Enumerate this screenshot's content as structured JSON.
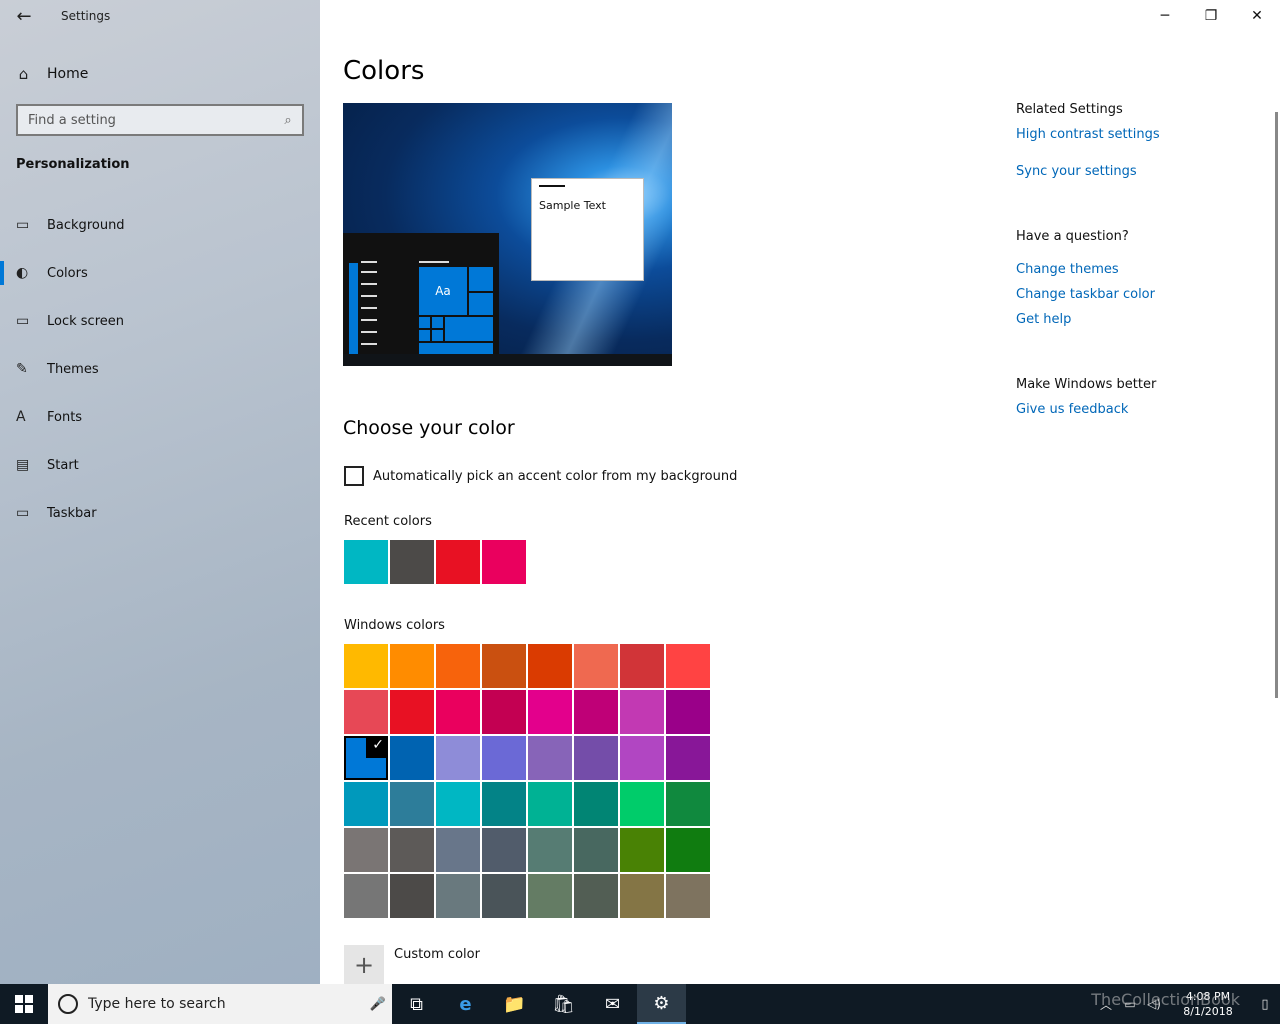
{
  "window": {
    "title": "Settings",
    "back_icon": "←",
    "minimize": "─",
    "maximize": "❐",
    "close": "✕"
  },
  "sidebar": {
    "home_label": "Home",
    "home_icon": "⌂",
    "search_placeholder": "Find a setting",
    "search_icon": "⌕",
    "section": "Personalization",
    "items": [
      {
        "label": "Background",
        "icon": "▭",
        "active": false
      },
      {
        "label": "Colors",
        "icon": "◐",
        "active": true
      },
      {
        "label": "Lock screen",
        "icon": "▭",
        "active": false
      },
      {
        "label": "Themes",
        "icon": "✎",
        "active": false
      },
      {
        "label": "Fonts",
        "icon": "A",
        "active": false
      },
      {
        "label": "Start",
        "icon": "▤",
        "active": false
      },
      {
        "label": "Taskbar",
        "icon": "▭",
        "active": false
      }
    ]
  },
  "main": {
    "title": "Colors",
    "preview": {
      "sample_text": "Sample Text",
      "tile_text": "Aa"
    },
    "choose_heading": "Choose your color",
    "auto_pick_label": "Automatically pick an accent color from my background",
    "auto_pick_checked": false,
    "recent_label": "Recent colors",
    "recent_colors": [
      "#00b7c3",
      "#4c4a48",
      "#e81123",
      "#ea005e"
    ],
    "windows_label": "Windows colors",
    "windows_colors": [
      "#ffb900",
      "#ff8c00",
      "#f7630c",
      "#ca5010",
      "#da3b01",
      "#ef6950",
      "#d13438",
      "#ff4343",
      "#e74856",
      "#e81123",
      "#ea005e",
      "#c30052",
      "#e3008c",
      "#bf0077",
      "#c239b3",
      "#9a0089",
      "#0078d7",
      "#0063b1",
      "#8e8cd8",
      "#6b69d6",
      "#8764b8",
      "#744da9",
      "#b146c2",
      "#881798",
      "#0099bc",
      "#2d7d9a",
      "#00b7c3",
      "#038387",
      "#00b294",
      "#018574",
      "#00cc6a",
      "#10893e",
      "#7a7574",
      "#5d5a58",
      "#68768a",
      "#515c6b",
      "#567c73",
      "#486860",
      "#498205",
      "#107c10",
      "#767676",
      "#4c4a48",
      "#69797e",
      "#4a5459",
      "#647c64",
      "#525e54",
      "#847545",
      "#7e735f"
    ],
    "selected_index": 16,
    "check_mark": "✓",
    "custom_color_label": "Custom color",
    "custom_color_icon": "+"
  },
  "related": {
    "heading": "Related Settings",
    "links": [
      "High contrast settings",
      "Sync your settings"
    ],
    "question_heading": "Have a question?",
    "question_links": [
      "Change themes",
      "Change taskbar color",
      "Get help"
    ],
    "better_heading": "Make Windows better",
    "better_links": [
      "Give us feedback"
    ]
  },
  "taskbar": {
    "search_placeholder": "Type here to search",
    "mic_icon": "🎤",
    "task_view_icon": "⧉",
    "edge_icon": "e",
    "explorer_icon": "📁",
    "store_icon": "🛍",
    "mail_icon": "✉",
    "settings_icon": "⚙",
    "time": "4:08 PM",
    "date": "8/1/2018",
    "watermark": "TheCollectionBook",
    "colors": {
      "background": "#0f1a24",
      "accent": "#0078d7"
    }
  }
}
